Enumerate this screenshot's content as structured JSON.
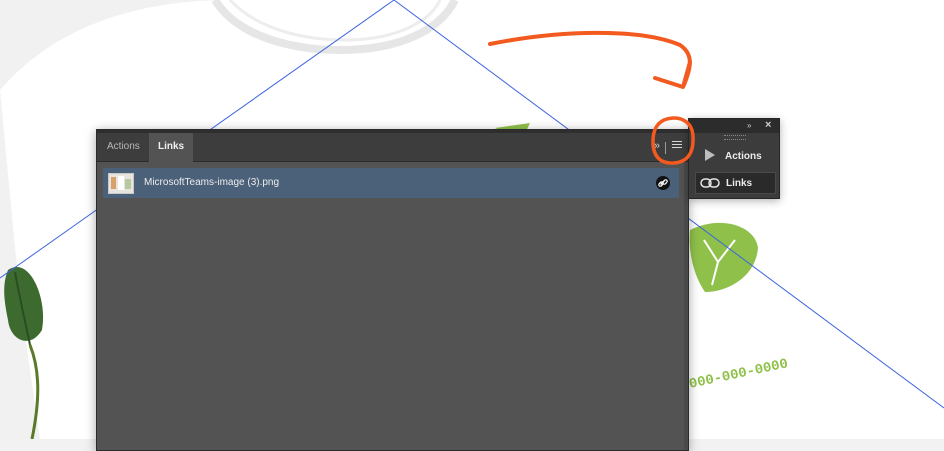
{
  "canvas": {
    "phone_text": "000-000-0000"
  },
  "colors": {
    "annotation": "#f25a1f",
    "guide": "#3c64e0",
    "leaf_green": "#8fc14a",
    "panel_bg": "#535353",
    "selected_row": "#4b6079"
  },
  "links_panel": {
    "tabs": [
      {
        "label": "Actions",
        "active": false
      },
      {
        "label": "Links",
        "active": true
      }
    ],
    "collapse_glyph": "»",
    "items": [
      {
        "filename": "MicrosoftTeams-image (3).png",
        "status_icon": "link-icon",
        "selected": true
      }
    ]
  },
  "mini_panel": {
    "collapse_glyph": "»",
    "close_glyph": "×",
    "items": [
      {
        "label": "Actions",
        "icon": "play-icon"
      },
      {
        "label": "Links",
        "icon": "chain-link-icon"
      }
    ]
  }
}
